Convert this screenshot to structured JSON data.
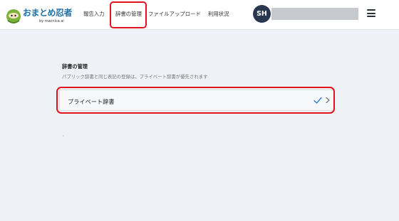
{
  "app": {
    "logo_text": "おまとめ忍者",
    "logo_subtext": "by macnica ai"
  },
  "nav": {
    "items": [
      {
        "label": "報告入力"
      },
      {
        "label": "辞書の管理"
      },
      {
        "label": "ファイルアップロード"
      },
      {
        "label": "利用状況"
      }
    ]
  },
  "user": {
    "initials": "SH"
  },
  "main": {
    "section_title": "辞書の管理",
    "section_description": "パブリック辞書と同じ表記の登録は、プライベート辞書が優先されます",
    "dictionary_items": [
      {
        "label": "プライベート辞書"
      }
    ]
  },
  "icons": {
    "menu": "hamburger-icon",
    "check": "check-icon",
    "chevron": "chevron-right-icon"
  },
  "colors": {
    "highlight": "#e0141b",
    "avatar_bg": "#28364f",
    "check": "#2f7fd0",
    "page_bg": "#eef2f7"
  }
}
